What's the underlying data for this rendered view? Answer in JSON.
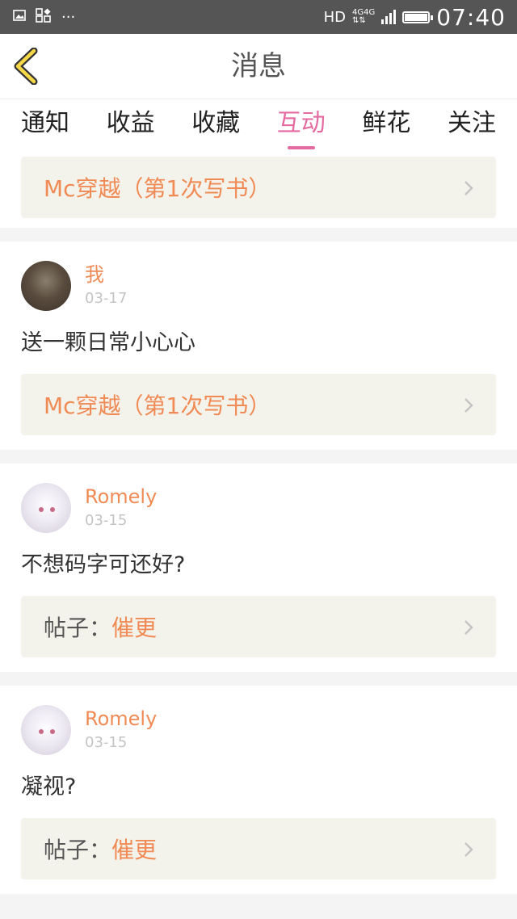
{
  "status": {
    "hd": "HD",
    "net1": "4G",
    "net2": "4G",
    "time": "07:40",
    "dots": "···"
  },
  "header": {
    "title": "消息"
  },
  "tabs": [
    {
      "label": "通知"
    },
    {
      "label": "收益"
    },
    {
      "label": "收藏"
    },
    {
      "label": "互动",
      "active": true
    },
    {
      "label": "鲜花"
    },
    {
      "label": "关注"
    }
  ],
  "first_ref": "Mc穿越（第1次写书）",
  "items": [
    {
      "name": "我",
      "date": "03-17",
      "content": "送一颗日常小心心",
      "ref_prefix": "",
      "ref": "Mc穿越（第1次写书）"
    },
    {
      "name": "Romely",
      "date": "03-15",
      "content": "不想码字可还好?",
      "ref_prefix": "帖子：",
      "ref": "催更"
    },
    {
      "name": "Romely",
      "date": "03-15",
      "content": "凝视?",
      "ref_prefix": "帖子：",
      "ref": "催更"
    }
  ],
  "colors": {
    "accent": "#e56aa0",
    "orange": "#f08b55",
    "statusbar": "#555555"
  }
}
